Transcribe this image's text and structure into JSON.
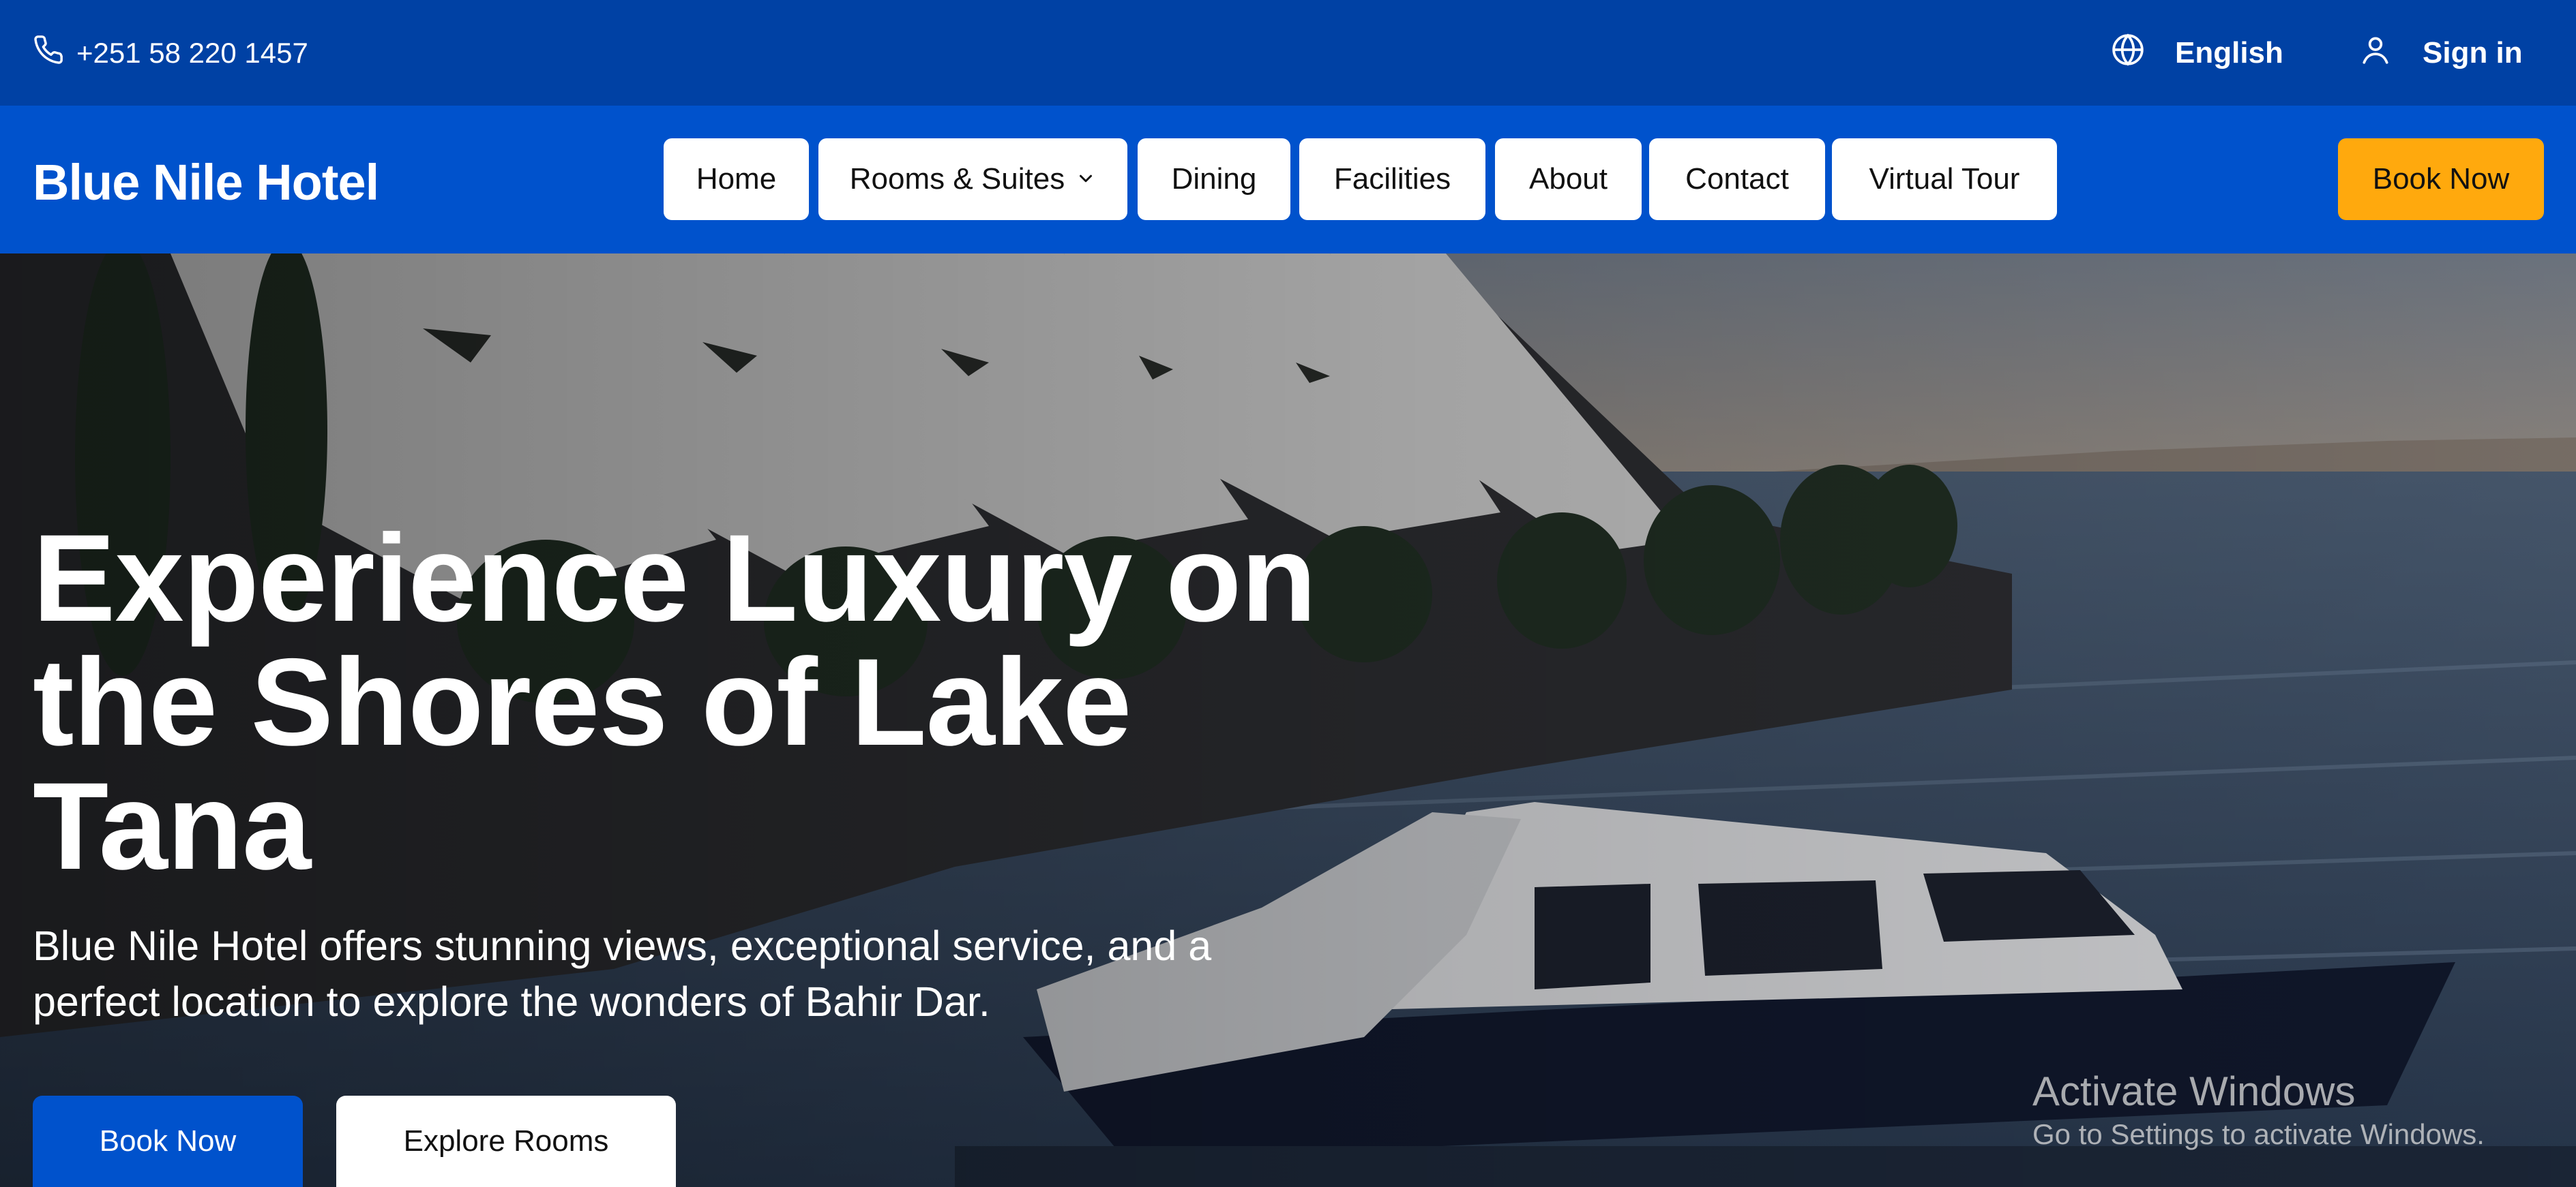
{
  "topbar": {
    "phone_icon": "phone-icon",
    "phone": "+251 58 220 1457",
    "language_icon": "globe-icon",
    "language": "English",
    "signin_icon": "user-icon",
    "signin": "Sign in"
  },
  "navbar": {
    "brand": "Blue Nile Hotel",
    "items": [
      {
        "label": "Home"
      },
      {
        "label": "Rooms & Suites",
        "icon": "chevron-down-icon"
      },
      {
        "label": "Dining"
      },
      {
        "label": "Facilities"
      },
      {
        "label": "About"
      },
      {
        "label": "Contact"
      },
      {
        "label": "Virtual Tour"
      }
    ],
    "book_now": "Book Now"
  },
  "hero": {
    "title": "Experience Luxury on the Shores of Lake Tana",
    "subtitle": "Blue Nile Hotel offers stunning views, exceptional service, and a perfect location to explore the wonders of Bahir Dar.",
    "primary_button": "Book Now",
    "secondary_button": "Explore Rooms"
  },
  "watermark": {
    "title": "Activate Windows",
    "subtitle": "Go to Settings to activate Windows."
  },
  "colors": {
    "topbar": "#0041a4",
    "navbar": "#0052cc",
    "accent": "#ffa90d",
    "button_primary": "#0052cc"
  }
}
